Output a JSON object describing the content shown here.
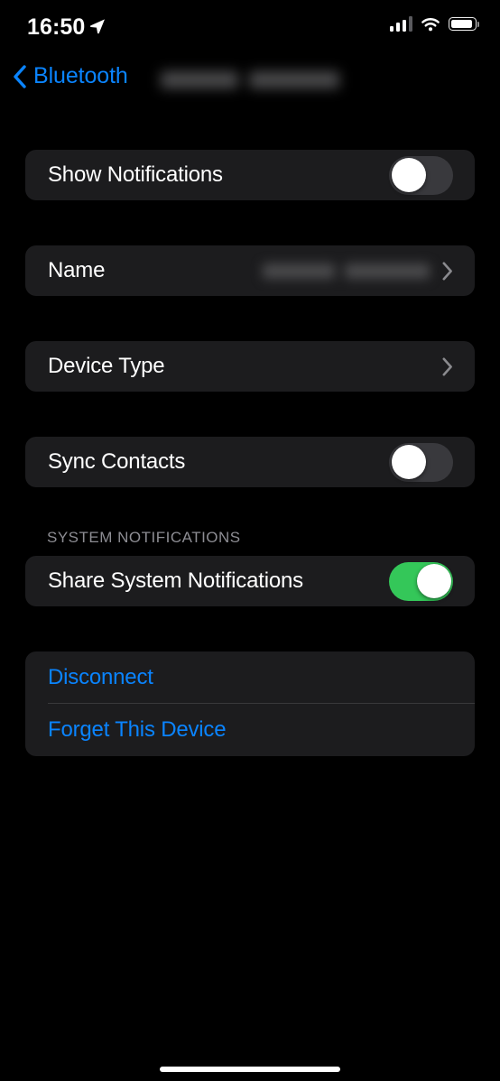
{
  "status_bar": {
    "time": "16:50",
    "location_icon": "location-arrow-icon",
    "cellular_icon": "cellular-signal-icon",
    "cellular_bars_filled": 3,
    "cellular_bars_total": 4,
    "wifi_icon": "wifi-icon",
    "battery_icon": "battery-icon",
    "battery_level_percent": 88
  },
  "nav_bar": {
    "back_label": "Bluetooth",
    "back_icon": "chevron-left-icon",
    "title_redacted": true,
    "title": ""
  },
  "sections": [
    {
      "header": "",
      "rows": [
        {
          "label": "Show Notifications",
          "type": "toggle",
          "value": "off"
        }
      ]
    },
    {
      "header": "",
      "rows": [
        {
          "label": "Name",
          "type": "disclosure",
          "value_redacted": true,
          "value": "",
          "accessory_icon": "chevron-right-icon"
        }
      ]
    },
    {
      "header": "",
      "rows": [
        {
          "label": "Device Type",
          "type": "disclosure",
          "value": "",
          "accessory_icon": "chevron-right-icon"
        }
      ]
    },
    {
      "header": "",
      "rows": [
        {
          "label": "Sync Contacts",
          "type": "toggle",
          "value": "off"
        }
      ]
    },
    {
      "header": "SYSTEM NOTIFICATIONS",
      "rows": [
        {
          "label": "Share System Notifications",
          "type": "toggle",
          "value": "on"
        }
      ]
    }
  ],
  "actions": {
    "disconnect_label": "Disconnect",
    "forget_label": "Forget This Device"
  },
  "colors": {
    "background": "#000000",
    "card": "#1C1C1E",
    "accent_blue": "#0A84FF",
    "toggle_on_green": "#34C759",
    "toggle_off_gray": "#39393D",
    "secondary_text": "#8D8D93",
    "divider": "#38383A",
    "primary_text": "#FFFFFF"
  },
  "home_indicator": "home-indicator"
}
